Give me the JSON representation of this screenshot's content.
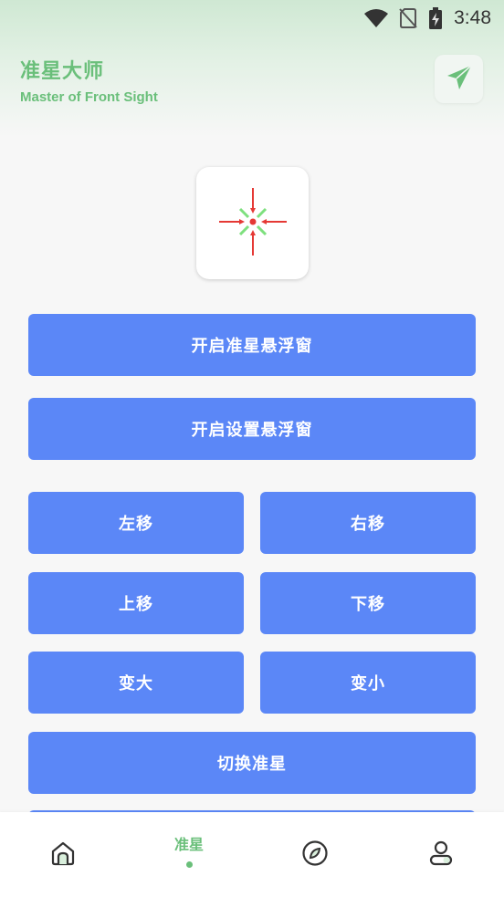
{
  "status_bar": {
    "time": "3:48",
    "icons": [
      "wifi-icon",
      "sim-off-icon",
      "battery-charging-icon"
    ]
  },
  "header": {
    "title": "准星大师",
    "subtitle": "Master of Front Sight",
    "share_icon": "send-icon"
  },
  "buttons": {
    "open_crosshair_float": "开启准星悬浮窗",
    "open_settings_float": "开启设置悬浮窗",
    "move_left": "左移",
    "move_right": "右移",
    "move_up": "上移",
    "move_down": "下移",
    "enlarge": "变大",
    "shrink": "变小",
    "switch_crosshair": "切换准星"
  },
  "bottom_nav": {
    "items": [
      {
        "icon": "home-icon",
        "label": ""
      },
      {
        "icon": "",
        "label": "准星",
        "active": true
      },
      {
        "icon": "compass-icon",
        "label": ""
      },
      {
        "icon": "profile-icon",
        "label": ""
      }
    ]
  },
  "colors": {
    "accent_green": "#6abf7a",
    "button_blue": "#5b87f7",
    "crosshair_red": "#e53935",
    "crosshair_green": "#7ee07e"
  }
}
